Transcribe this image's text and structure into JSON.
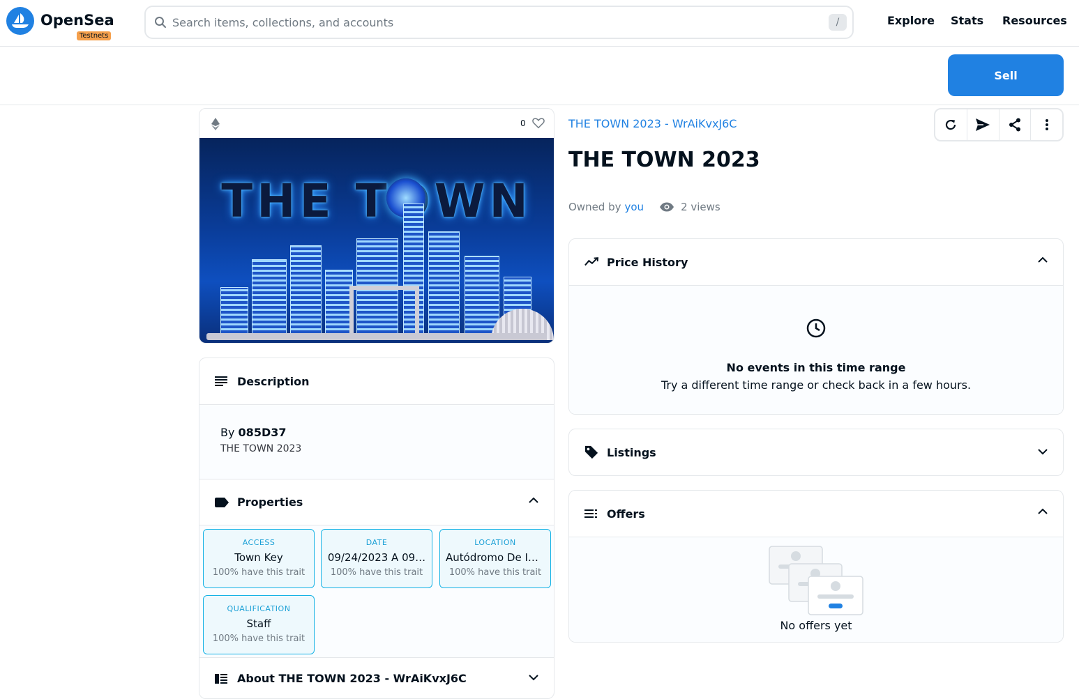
{
  "header": {
    "logo_text": "OpenSea",
    "badge": "Testnets",
    "search_placeholder": "Search items, collections, and accounts",
    "search_shortcut": "/",
    "nav": [
      "Explore",
      "Stats",
      "Resources"
    ]
  },
  "subbar": {
    "sell_label": "Sell"
  },
  "item": {
    "favorites_count": "0",
    "art_text": "THE TOWN",
    "collection_link": "THE TOWN 2023 - WrAiKvxJ6C",
    "title": "THE TOWN 2023",
    "owned_by_label": "Owned by",
    "owner": "you",
    "views": "2 views"
  },
  "description": {
    "heading": "Description",
    "by_label": "By",
    "creator": "085D37",
    "text": "THE TOWN 2023"
  },
  "properties": {
    "heading": "Properties",
    "traits": [
      {
        "type": "ACCESS",
        "value": "Town Key",
        "rarity": "100% have this trait"
      },
      {
        "type": "DATE",
        "value": "09/24/2023 A 09…",
        "rarity": "100% have this trait"
      },
      {
        "type": "LOCATION",
        "value": "Autódromo De In…",
        "rarity": "100% have this trait"
      },
      {
        "type": "QUALIFICATION",
        "value": "Staff",
        "rarity": "100% have this trait"
      }
    ]
  },
  "about": {
    "heading": "About THE TOWN 2023 - WrAiKvxJ6C"
  },
  "price_history": {
    "heading": "Price History",
    "empty_title": "No events in this time range",
    "empty_sub": "Try a different time range or check back in a few hours."
  },
  "listings": {
    "heading": "Listings"
  },
  "offers": {
    "heading": "Offers",
    "empty": "No offers yet"
  },
  "colors": {
    "accent": "#2081e2",
    "badge": "#f5a04c",
    "trait_border": "#15b2e5"
  }
}
